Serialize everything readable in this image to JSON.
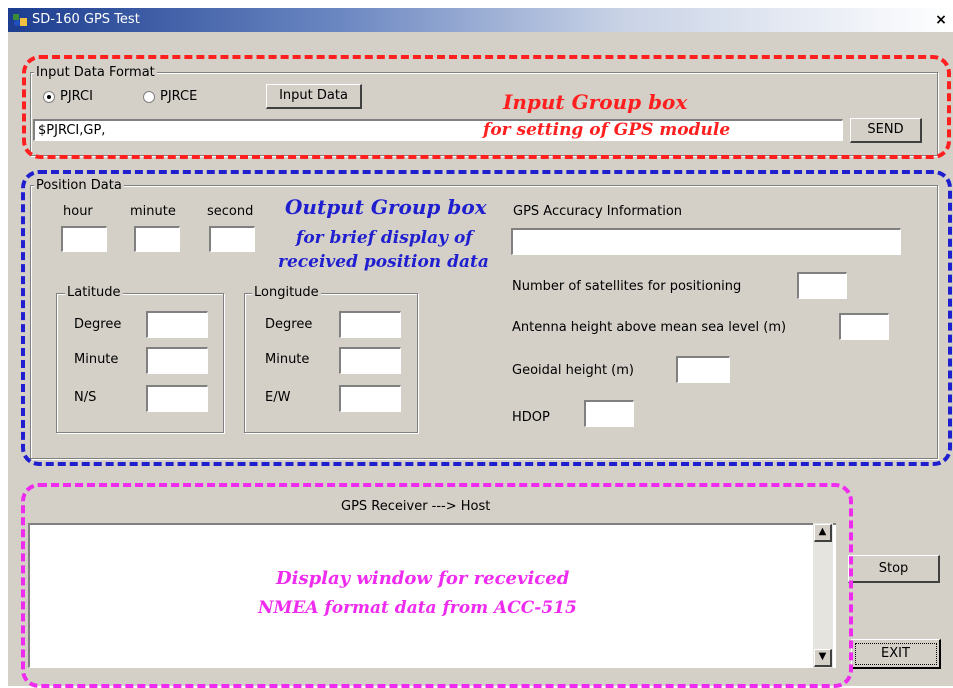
{
  "window": {
    "title": "SD-160 GPS Test",
    "close_symbol": "×"
  },
  "input_group": {
    "label": "Input Data Format",
    "radio_options": [
      "PJRCI",
      "PJRCE"
    ],
    "selected_option": "PJRCI",
    "input_data_button": "Input Data",
    "command_value": "$PJRCI,GP,",
    "send_button": "SEND"
  },
  "position_group": {
    "label": "Position Data",
    "time_labels": [
      "hour",
      "minute",
      "second"
    ],
    "latitude": {
      "label": "Latitude",
      "rows": [
        "Degree",
        "Minute",
        "N/S"
      ]
    },
    "longitude": {
      "label": "Longitude",
      "rows": [
        "Degree",
        "Minute",
        "E/W"
      ]
    },
    "accuracy_label": "GPS Accuracy Information",
    "satellites_label": "Number of satellites for positioning",
    "antenna_label": "Antenna height above mean sea level (m)",
    "geoidal_label": "Geoidal height (m)",
    "hdop_label": "HDOP"
  },
  "receiver_label": "GPS Receiver ---> Host",
  "buttons": {
    "stop": "Stop",
    "exit": "EXIT"
  },
  "annotations": {
    "input_title": "Input Group box",
    "input_sub": "for setting of GPS module",
    "output_title": "Output Group box",
    "output_sub1": "for brief  display of",
    "output_sub2": "received position data",
    "display_line1": "Display window for receviced",
    "display_line2": "NMEA format data from ACC-515"
  },
  "colors": {
    "annotation_red": "#ff1f1f",
    "annotation_blue": "#1f1fcf",
    "annotation_magenta": "#ee2bee",
    "window_bg": "#d4d0c8"
  }
}
